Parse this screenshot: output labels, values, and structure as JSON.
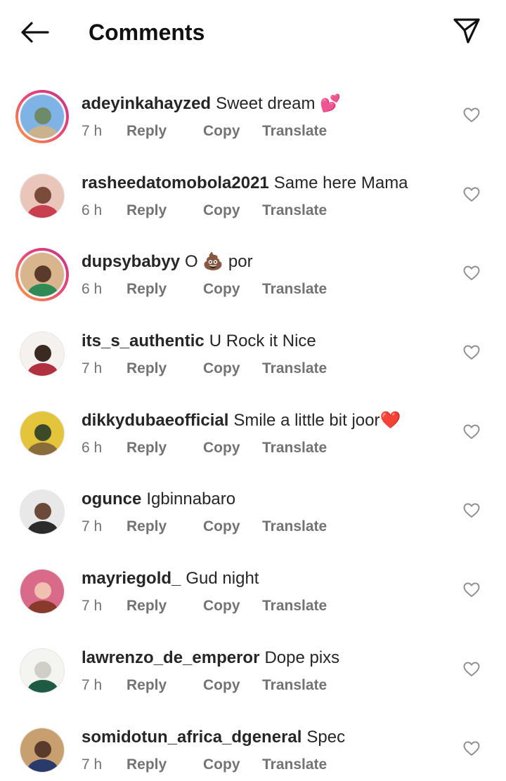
{
  "header": {
    "title": "Comments",
    "back_icon": "arrow-left-icon",
    "send_icon": "paper-plane-icon"
  },
  "actions": {
    "reply": "Reply",
    "copy": "Copy",
    "translate": "Translate"
  },
  "colors": {
    "text": "#262626",
    "meta": "#737373",
    "story_ring_start": "#f9a03f",
    "story_ring_end": "#c13584"
  },
  "comments": [
    {
      "username": "adeyinkahayzed",
      "text": "Sweet dream 💕",
      "time": "7 h",
      "story_ring": true,
      "avatar_colors": [
        "#7fb3e6",
        "#c9b28c",
        "#6d8a6a"
      ]
    },
    {
      "username": "rasheedatomobola2021",
      "text": "Same here Mama",
      "time": "6 h",
      "story_ring": false,
      "avatar_colors": [
        "#e9c6b9",
        "#c8404f",
        "#7a4a3a"
      ]
    },
    {
      "username": "dupsybabyy",
      "text": "O 💩 por",
      "time": "6 h",
      "story_ring": true,
      "avatar_colors": [
        "#d8b58c",
        "#2f8a55",
        "#5a3a2a"
      ]
    },
    {
      "username": "its_s_authentic",
      "text": "U Rock it Nice",
      "time": "7 h",
      "story_ring": false,
      "avatar_colors": [
        "#f5f1ee",
        "#b03040",
        "#3a2a22"
      ]
    },
    {
      "username": "dikkydubaeofficial",
      "text": "Smile a little bit joor❤️",
      "time": "6 h",
      "story_ring": false,
      "avatar_colors": [
        "#e3c43a",
        "#8a6b3a",
        "#3c4a2a"
      ]
    },
    {
      "username": "ogunce",
      "text": "Igbinnabaro",
      "time": "7 h",
      "story_ring": false,
      "avatar_colors": [
        "#e8e8e8",
        "#2b2b2b",
        "#6b4a3a"
      ]
    },
    {
      "username": "mayriegold_",
      "text": "Gud night",
      "time": "7 h",
      "story_ring": false,
      "avatar_colors": [
        "#d96a8a",
        "#8a3a2a",
        "#f0c0b0"
      ]
    },
    {
      "username": "lawrenzo_de_emperor",
      "text": "Dope pixs",
      "time": "7 h",
      "story_ring": false,
      "avatar_colors": [
        "#f4f4f0",
        "#1f5a45",
        "#cfcfc8"
      ]
    },
    {
      "username": "somidotun_africa_dgeneral",
      "text": "Spec",
      "time": "7 h",
      "story_ring": false,
      "avatar_colors": [
        "#c8a070",
        "#2a3a6a",
        "#5a3a2a"
      ]
    }
  ]
}
